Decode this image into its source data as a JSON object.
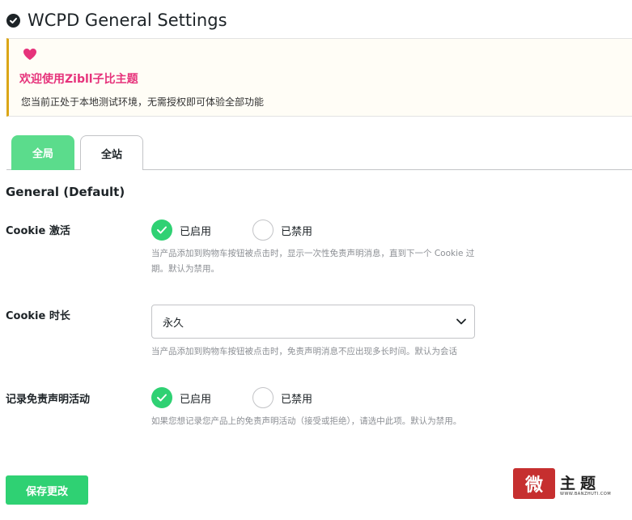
{
  "header": {
    "title": "WCPD General Settings",
    "icon": "check-circle-icon"
  },
  "notice": {
    "icon": "heart-icon",
    "title": "欢迎使用Zibll子比主题",
    "text": "您当前正处于本地测试环境，无需授权即可体验全部功能",
    "accent_color": "#dba617",
    "title_color": "#e6337b"
  },
  "tabs": [
    {
      "label": "全局",
      "active": true
    },
    {
      "label": "全站",
      "active": false
    }
  ],
  "section": {
    "title": "General (Default)"
  },
  "fields": {
    "cookie_activation": {
      "label": "Cookie 激活",
      "options": [
        "已启用",
        "已禁用"
      ],
      "selected": "已启用",
      "description": "当产品添加到购物车按钮被点击时，显示一次性免责声明消息，直到下一个 Cookie 过期。默认为禁用。"
    },
    "cookie_duration": {
      "label": "Cookie 时长",
      "value": "永久",
      "description": "当产品添加到购物车按钮被点击时，免责声明消息不应出现多长时间。默认为会话"
    },
    "record_activity": {
      "label": "记录免责声明活动",
      "options": [
        "已启用",
        "已禁用"
      ],
      "selected": "已启用",
      "description": "如果您想记录您产品上的免责声明活动（接受或拒绝），请选中此项。默认为禁用。"
    }
  },
  "actions": {
    "save_label": "保存更改"
  },
  "watermark": {
    "seal": "微",
    "text": "主题",
    "url": "WWW.BANZHUTI.COM"
  },
  "colors": {
    "accent_green": "#2fd173",
    "tab_green": "#5bdc8c"
  }
}
